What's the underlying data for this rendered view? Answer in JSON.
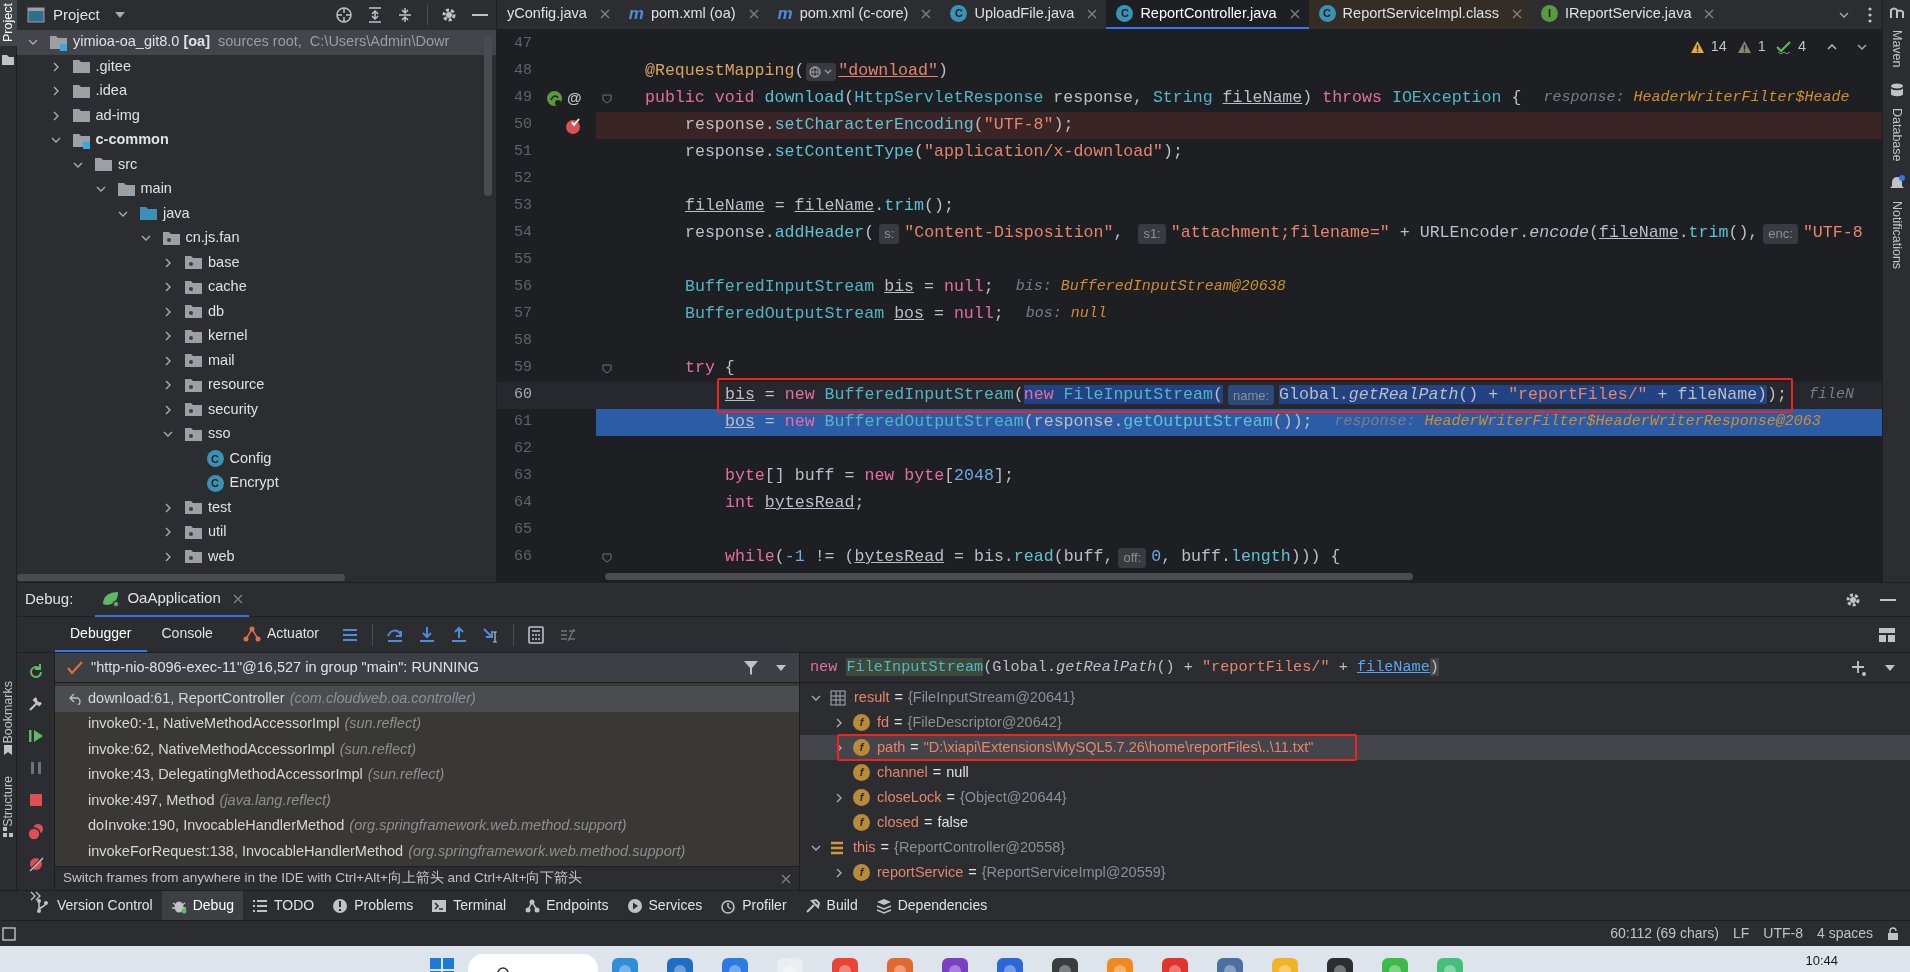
{
  "left_strip": {
    "top": {
      "label": "Project",
      "selected": true
    },
    "bottom": [
      "Bookmarks",
      "Structure"
    ]
  },
  "project_panel": {
    "title": "Project",
    "tree": [
      {
        "name": "yimioa-oa_git8.0",
        "tag": "[oa]",
        "detail": "sources root,  C:\\Users\\Admin\\Dowr",
        "kind": "root",
        "expanded": true,
        "selected": true,
        "children": [
          {
            "name": ".gitee",
            "kind": "folder",
            "expanded": false,
            "selected": false
          },
          {
            "name": ".idea",
            "kind": "folder",
            "expanded": false,
            "selected": false
          },
          {
            "name": "ad-img",
            "kind": "folder",
            "expanded": false,
            "selected": false
          },
          {
            "name": "c-common",
            "kind": "module",
            "expanded": true,
            "selected": false,
            "children": [
              {
                "name": "src",
                "kind": "folder",
                "expanded": true,
                "selected": false,
                "children": [
                  {
                    "name": "main",
                    "kind": "folder",
                    "expanded": true,
                    "selected": false,
                    "children": [
                      {
                        "name": "java",
                        "kind": "source",
                        "expanded": true,
                        "selected": false,
                        "children": [
                          {
                            "name": "cn.js.fan",
                            "kind": "package",
                            "expanded": true,
                            "selected": false,
                            "children": [
                              {
                                "name": "base",
                                "kind": "package",
                                "expanded": false,
                                "selected": false
                              },
                              {
                                "name": "cache",
                                "kind": "package",
                                "expanded": false,
                                "selected": false
                              },
                              {
                                "name": "db",
                                "kind": "package",
                                "expanded": false,
                                "selected": false
                              },
                              {
                                "name": "kernel",
                                "kind": "package",
                                "expanded": false,
                                "selected": false
                              },
                              {
                                "name": "mail",
                                "kind": "package",
                                "expanded": false,
                                "selected": false
                              },
                              {
                                "name": "resource",
                                "kind": "package",
                                "expanded": false,
                                "selected": false
                              },
                              {
                                "name": "security",
                                "kind": "package",
                                "expanded": false,
                                "selected": false
                              },
                              {
                                "name": "sso",
                                "kind": "package",
                                "expanded": true,
                                "selected": false,
                                "children": [
                                  {
                                    "name": "Config",
                                    "kind": "class",
                                    "badge": "C",
                                    "selected": false
                                  },
                                  {
                                    "name": "Encrypt",
                                    "kind": "class",
                                    "badge": "C",
                                    "selected": false
                                  }
                                ]
                              },
                              {
                                "name": "test",
                                "kind": "package",
                                "expanded": false,
                                "selected": false
                              },
                              {
                                "name": "util",
                                "kind": "package",
                                "expanded": false,
                                "selected": false
                              },
                              {
                                "name": "web",
                                "kind": "package",
                                "expanded": false,
                                "selected": false
                              }
                            ]
                          }
                        ]
                      }
                    ]
                  }
                ]
              }
            ]
          }
        ]
      }
    ]
  },
  "editor": {
    "tabs": [
      {
        "label": "yConfig.java",
        "kind": "plain",
        "selected": false
      },
      {
        "label": "pom.xml (oa)",
        "kind": "maven",
        "badge": "m",
        "selected": false
      },
      {
        "label": "pom.xml (c-core)",
        "kind": "maven",
        "badge": "m",
        "selected": false
      },
      {
        "label": "UploadFile.java",
        "kind": "java",
        "badge": "C",
        "selected": false
      },
      {
        "label": "ReportController.java",
        "kind": "java",
        "badge": "C",
        "selected": true
      },
      {
        "label": "ReportServiceImpl.class",
        "kind": "class",
        "badge": "C",
        "selected": false
      },
      {
        "label": "IReportService.java",
        "kind": "interface",
        "badge": "I",
        "selected": false
      }
    ],
    "inspections": [
      {
        "kind": "warning",
        "count": "14"
      },
      {
        "kind": "weak",
        "count": "1"
      },
      {
        "kind": "ok",
        "count": "4"
      }
    ],
    "lines": [
      {
        "n": "47",
        "kind": "plain",
        "fold": false
      },
      {
        "n": "48",
        "kind": "plain",
        "fold": false,
        "tokens": [
          {
            "t": "@RequestMapping",
            "kind": "ann"
          },
          {
            "t": "(",
            "kind": "p"
          },
          {
            "kind": "url-inlay"
          },
          {
            "t": "\"download\"",
            "kind": "strlink"
          },
          {
            "t": ")",
            "kind": "p"
          }
        ]
      },
      {
        "n": "49",
        "kind": "method",
        "gutter_mark": "@",
        "fold": true,
        "tokens": [
          {
            "t": "public void ",
            "kind": "kw"
          },
          {
            "t": "download",
            "kind": "fn"
          },
          {
            "t": "(",
            "kind": "p"
          },
          {
            "t": "HttpServletResponse",
            "kind": "ty"
          },
          {
            "t": " response, ",
            "kind": "p"
          },
          {
            "t": "String ",
            "kind": "ty"
          },
          {
            "t": "fileName",
            "kind": "u"
          },
          {
            "t": ") ",
            "kind": "p"
          },
          {
            "t": "throws ",
            "kind": "kw"
          },
          {
            "t": "IOException",
            "kind": "ty"
          },
          {
            "t": " {",
            "kind": "p"
          },
          {
            "t": "response:",
            "kind": "dl"
          },
          {
            "t": "HeaderWriterFilter$Heade",
            "kind": "dv"
          }
        ],
        "children": [
          {
            "n": "50",
            "kind": "breakpoint",
            "fold": false,
            "tokens": [
              {
                "t": "response.",
                "kind": "p"
              },
              {
                "t": "setCharacterEncoding",
                "kind": "fn"
              },
              {
                "t": "(",
                "kind": "p"
              },
              {
                "t": "\"UTF-8\"",
                "kind": "str"
              },
              {
                "t": ");",
                "kind": "p"
              }
            ]
          },
          {
            "n": "51",
            "kind": "plain",
            "fold": false,
            "tokens": [
              {
                "t": "response.",
                "kind": "p"
              },
              {
                "t": "setContentType",
                "kind": "fn"
              },
              {
                "t": "(",
                "kind": "p"
              },
              {
                "t": "\"application/x-download\"",
                "kind": "str"
              },
              {
                "t": ");",
                "kind": "p"
              }
            ]
          },
          {
            "n": "52",
            "kind": "plain",
            "fold": false
          },
          {
            "n": "53",
            "kind": "plain",
            "fold": false,
            "tokens": [
              {
                "t": "fileName",
                "kind": "u"
              },
              {
                "t": " = ",
                "kind": "p"
              },
              {
                "t": "fileName",
                "kind": "u"
              },
              {
                "t": ".",
                "kind": "p"
              },
              {
                "t": "trim",
                "kind": "fn"
              },
              {
                "t": "();",
                "kind": "p"
              }
            ]
          },
          {
            "n": "54",
            "kind": "plain",
            "fold": false,
            "tokens": [
              {
                "t": "response.",
                "kind": "p"
              },
              {
                "t": "addHeader",
                "kind": "fn"
              },
              {
                "t": "(",
                "kind": "p"
              },
              {
                "t": "s:",
                "kind": "inlay"
              },
              {
                "t": "\"Content-Disposition\"",
                "kind": "str"
              },
              {
                "t": ", ",
                "kind": "p"
              },
              {
                "t": "s1:",
                "kind": "inlay"
              },
              {
                "t": "\"attachment;filename=\"",
                "kind": "str"
              },
              {
                "t": " + URLEncoder.",
                "kind": "p"
              },
              {
                "t": "encode",
                "kind": "st"
              },
              {
                "t": "(",
                "kind": "p"
              },
              {
                "t": "fileName",
                "kind": "u"
              },
              {
                "t": ".",
                "kind": "p"
              },
              {
                "t": "trim",
                "kind": "fn"
              },
              {
                "t": "(),",
                "kind": "p"
              },
              {
                "t": "enc:",
                "kind": "inlay"
              },
              {
                "t": "\"UTF-8",
                "kind": "str"
              }
            ]
          },
          {
            "n": "55",
            "kind": "plain",
            "fold": false
          },
          {
            "n": "56",
            "kind": "plain",
            "fold": false,
            "tokens": [
              {
                "t": "BufferedInputStream ",
                "kind": "ty"
              },
              {
                "t": "bis",
                "kind": "u"
              },
              {
                "t": " = ",
                "kind": "p"
              },
              {
                "t": "null",
                "kind": "kw"
              },
              {
                "t": ";",
                "kind": "p"
              },
              {
                "t": "bis:",
                "kind": "dl"
              },
              {
                "t": "BufferedInputStream@20638",
                "kind": "dv"
              }
            ]
          },
          {
            "n": "57",
            "kind": "plain",
            "fold": false,
            "tokens": [
              {
                "t": "BufferedOutputStream ",
                "kind": "ty"
              },
              {
                "t": "bos",
                "kind": "u"
              },
              {
                "t": " = ",
                "kind": "p"
              },
              {
                "t": "null",
                "kind": "kw"
              },
              {
                "t": ";",
                "kind": "p"
              },
              {
                "t": "bos:",
                "kind": "dl"
              },
              {
                "t": "null",
                "kind": "dv"
              }
            ]
          },
          {
            "n": "58",
            "kind": "plain",
            "fold": false
          },
          {
            "n": "59",
            "kind": "plain",
            "fold": true,
            "tokens": [
              {
                "t": "try",
                "kind": "kw"
              },
              {
                "t": " {",
                "kind": "p"
              }
            ],
            "children": [
              {
                "n": "60",
                "kind": "caret",
                "fold": false,
                "boxed": {
                  "before": [
                    {
                      "t": "bis",
                      "kind": "u"
                    },
                    {
                      "t": " = ",
                      "kind": "p"
                    },
                    {
                      "t": "new ",
                      "kind": "kw"
                    },
                    {
                      "t": "BufferedInputStream",
                      "kind": "ty"
                    },
                    {
                      "t": "(",
                      "kind": "p"
                    }
                  ],
                  "highlighted": [
                    {
                      "t": "new ",
                      "kind": "kw"
                    },
                    {
                      "t": "FileInputStream",
                      "kind": "ty"
                    },
                    {
                      "t": "(",
                      "kind": "p"
                    },
                    {
                      "t": "name:",
                      "kind": "inlay"
                    },
                    {
                      "t": "Global.",
                      "kind": "p"
                    },
                    {
                      "t": "getRealPath",
                      "kind": "st"
                    },
                    {
                      "t": "() + ",
                      "kind": "p"
                    },
                    {
                      "t": "\"reportFiles/\"",
                      "kind": "str"
                    },
                    {
                      "t": " + fileName)",
                      "kind": "p"
                    }
                  ],
                  "after": [
                    {
                      "t": ");",
                      "kind": "p"
                    }
                  ]
                },
                "after": [
                  {
                    "t": "fileN",
                    "kind": "dl"
                  }
                ]
              },
              {
                "n": "61",
                "kind": "execution",
                "fold": false,
                "tokens": [
                  {
                    "t": "bos",
                    "kind": "u"
                  },
                  {
                    "t": " = ",
                    "kind": "p"
                  },
                  {
                    "t": "new ",
                    "kind": "kw"
                  },
                  {
                    "t": "BufferedOutputStream",
                    "kind": "ty"
                  },
                  {
                    "t": "(response.",
                    "kind": "p"
                  },
                  {
                    "t": "getOutputStream",
                    "kind": "fn"
                  },
                  {
                    "t": "());",
                    "kind": "p"
                  },
                  {
                    "t": "response:",
                    "kind": "dl"
                  },
                  {
                    "t": "HeaderWriterFilter$HeaderWriterResponse@2063",
                    "kind": "dv"
                  }
                ]
              },
              {
                "n": "62",
                "kind": "plain",
                "fold": false
              },
              {
                "n": "63",
                "kind": "plain",
                "fold": false,
                "tokens": [
                  {
                    "t": "byte",
                    "kind": "kw"
                  },
                  {
                    "t": "[] buff = ",
                    "kind": "p"
                  },
                  {
                    "t": "new ",
                    "kind": "kw"
                  },
                  {
                    "t": "byte",
                    "kind": "kw"
                  },
                  {
                    "t": "[",
                    "kind": "p"
                  },
                  {
                    "t": "2048",
                    "kind": "num"
                  },
                  {
                    "t": "];",
                    "kind": "p"
                  }
                ]
              },
              {
                "n": "64",
                "kind": "plain",
                "fold": false,
                "tokens": [
                  {
                    "t": "int ",
                    "kind": "kw"
                  },
                  {
                    "t": "bytesRead",
                    "kind": "u"
                  },
                  {
                    "t": ";",
                    "kind": "p"
                  }
                ]
              },
              {
                "n": "65",
                "kind": "plain",
                "fold": false
              },
              {
                "n": "66",
                "kind": "plain",
                "fold": true,
                "tokens": [
                  {
                    "t": "while",
                    "kind": "kw"
                  },
                  {
                    "t": "(",
                    "kind": "p"
                  },
                  {
                    "t": "-1",
                    "kind": "num"
                  },
                  {
                    "t": " != (",
                    "kind": "p"
                  },
                  {
                    "t": "bytesRead",
                    "kind": "u"
                  },
                  {
                    "t": " = bis.",
                    "kind": "p"
                  },
                  {
                    "t": "read",
                    "kind": "fn"
                  },
                  {
                    "t": "(buff,",
                    "kind": "p"
                  },
                  {
                    "t": "off:",
                    "kind": "inlay"
                  },
                  {
                    "t": "0",
                    "kind": "num"
                  },
                  {
                    "t": ", buff.",
                    "kind": "p"
                  },
                  {
                    "t": "length",
                    "kind": "fn"
                  },
                  {
                    "t": "))) {",
                    "kind": "p"
                  }
                ]
              }
            ]
          }
        ]
      }
    ]
  },
  "right_strip": [
    "Maven",
    "Database",
    "Notifications"
  ],
  "debug": {
    "label": "Debug:",
    "run_tab": "OaApplication",
    "tabs": [
      {
        "label": "Debugger",
        "selected": true
      },
      {
        "label": "Console",
        "selected": false
      },
      {
        "label": "Actuator",
        "selected": false
      }
    ],
    "thread": "\"http-nio-8096-exec-11\"@16,527 in group \"main\": RUNNING",
    "frames": [
      {
        "method": "download:61, ReportController",
        "package": "(com.cloudweb.oa.controller)",
        "selected": true
      },
      {
        "method": "invoke0:-1, NativeMethodAccessorImpl",
        "package": "(sun.reflect)",
        "selected": false
      },
      {
        "method": "invoke:62, NativeMethodAccessorImpl",
        "package": "(sun.reflect)",
        "selected": false
      },
      {
        "method": "invoke:43, DelegatingMethodAccessorImpl",
        "package": "(sun.reflect)",
        "selected": false
      },
      {
        "method": "invoke:497, Method",
        "package": "(java.lang.reflect)",
        "selected": false
      },
      {
        "method": "doInvoke:190, InvocableHandlerMethod",
        "package": "(org.springframework.web.method.support)",
        "selected": false
      },
      {
        "method": "invokeForRequest:138, InvocableHandlerMethod",
        "package": "(org.springframework.web.method.support)",
        "selected": false
      }
    ],
    "hint": "Switch frames from anywhere in the IDE with Ctrl+Alt+向上箭头 and Ctrl+Alt+向下箭头",
    "expression": [
      {
        "t": "new ",
        "kind": "kw"
      },
      {
        "t": "FileInputStream",
        "kind": "tyhl"
      },
      {
        "t": "(Global.",
        "kind": "p"
      },
      {
        "t": "getRealPath",
        "kind": "st"
      },
      {
        "t": "() + ",
        "kind": "p"
      },
      {
        "t": "\"reportFiles/\"",
        "kind": "str"
      },
      {
        "t": " + ",
        "kind": "p"
      },
      {
        "t": "fileName",
        "kind": "link"
      },
      {
        "t": ")",
        "kind": "brace"
      }
    ],
    "variables": [
      {
        "name": "result",
        "op": "=",
        "value": {
          "t": "{FileInputStream@20641}",
          "kind": "object"
        },
        "kind": "result",
        "expanded": true,
        "selected": false,
        "children": [
          {
            "name": "fd",
            "op": "=",
            "value": {
              "t": "{FileDescriptor@20642}",
              "kind": "object"
            },
            "kind": "field",
            "badge": "f",
            "expanded": false,
            "selected": false
          },
          {
            "name": "path",
            "op": "=",
            "value": {
              "t": "\"D:\\xiapi\\Extensions\\MySQL5.7.26\\home\\reportFiles\\..\\11.txt\"",
              "kind": "string"
            },
            "kind": "field",
            "badge": "f",
            "expanded": false,
            "selected": true,
            "boxed": true
          },
          {
            "name": "channel",
            "op": "=",
            "value": {
              "t": "null",
              "kind": "literal"
            },
            "kind": "field",
            "badge": "f",
            "selected": false
          },
          {
            "name": "closeLock",
            "op": "=",
            "value": {
              "t": "{Object@20644}",
              "kind": "object"
            },
            "kind": "field",
            "badge": "f",
            "expanded": false,
            "selected": false
          },
          {
            "name": "closed",
            "op": "=",
            "value": {
              "t": "false",
              "kind": "literal"
            },
            "kind": "field",
            "badge": "f",
            "selected": false
          }
        ]
      },
      {
        "name": "this",
        "op": "=",
        "value": {
          "t": "{ReportController@20558}",
          "kind": "object"
        },
        "kind": "object",
        "expanded": true,
        "selected": false,
        "children": [
          {
            "name": "reportService",
            "op": "=",
            "value": {
              "t": "{ReportServiceImpl@20559}",
              "kind": "object"
            },
            "kind": "field",
            "badge": "f",
            "expanded": false,
            "selected": false
          }
        ]
      }
    ]
  },
  "tool_tabs": [
    {
      "label": "Version Control",
      "kind": "vcs",
      "selected": false
    },
    {
      "label": "Debug",
      "kind": "debug",
      "selected": true
    },
    {
      "label": "TODO",
      "kind": "todo",
      "selected": false
    },
    {
      "label": "Problems",
      "kind": "problems",
      "selected": false
    },
    {
      "label": "Terminal",
      "kind": "terminal",
      "selected": false
    },
    {
      "label": "Endpoints",
      "kind": "endpoints",
      "selected": false
    },
    {
      "label": "Services",
      "kind": "services",
      "selected": false
    },
    {
      "label": "Profiler",
      "kind": "profiler",
      "selected": false
    },
    {
      "label": "Build",
      "kind": "build",
      "selected": false
    },
    {
      "label": "Dependencies",
      "kind": "dependencies",
      "selected": false
    }
  ],
  "status_bar": {
    "items": [
      "60:112 (69 chars)",
      "LF",
      "UTF-8",
      "4 spaces"
    ]
  },
  "taskbar": {
    "time": "10:44"
  }
}
